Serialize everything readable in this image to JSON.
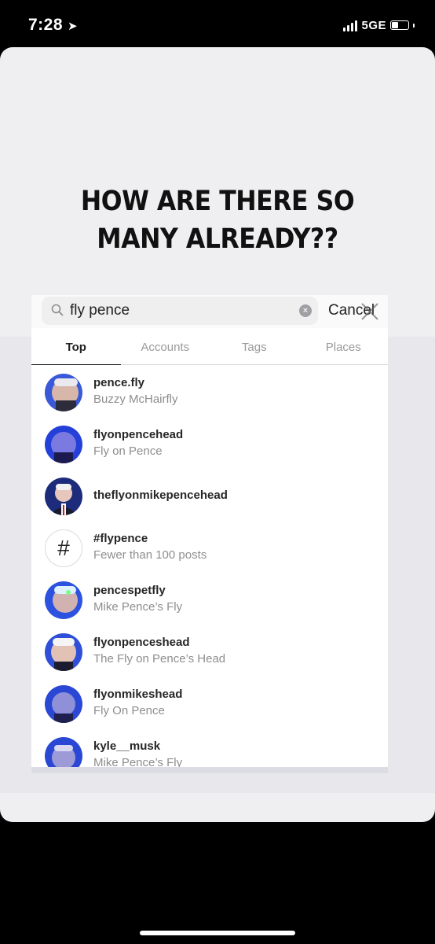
{
  "status": {
    "time": "7:28",
    "network": "5GE"
  },
  "story": {
    "headline_line1": "HOW ARE THERE SO",
    "headline_line2": "MANY ALREADY??"
  },
  "search": {
    "query": "fly pence",
    "cancel_label": "Cancel"
  },
  "tabs": [
    "Top",
    "Accounts",
    "Tags",
    "Places"
  ],
  "results": [
    {
      "name": "pence.fly",
      "subtitle": "Buzzy McHairfly",
      "type": "account"
    },
    {
      "name": "flyonpencehead",
      "subtitle": "Fly on Pence",
      "type": "account"
    },
    {
      "name": "theflyonmikepencehead",
      "subtitle": "",
      "type": "account"
    },
    {
      "name": "#flypence",
      "subtitle": "Fewer than 100 posts",
      "type": "tag"
    },
    {
      "name": "pencespetfly",
      "subtitle": "Mike Pence’s Fly",
      "type": "account"
    },
    {
      "name": "flyonpenceshead",
      "subtitle": "The Fly on Pence’s Head",
      "type": "account"
    },
    {
      "name": "flyonmikeshead",
      "subtitle": "Fly On Pence",
      "type": "account"
    },
    {
      "name": "kyle__musk",
      "subtitle": "Mike Pence’s Fly",
      "type": "account"
    }
  ],
  "colors": {
    "card_bg": "#efeff1",
    "avatar_blue": "#2d4fd6"
  }
}
